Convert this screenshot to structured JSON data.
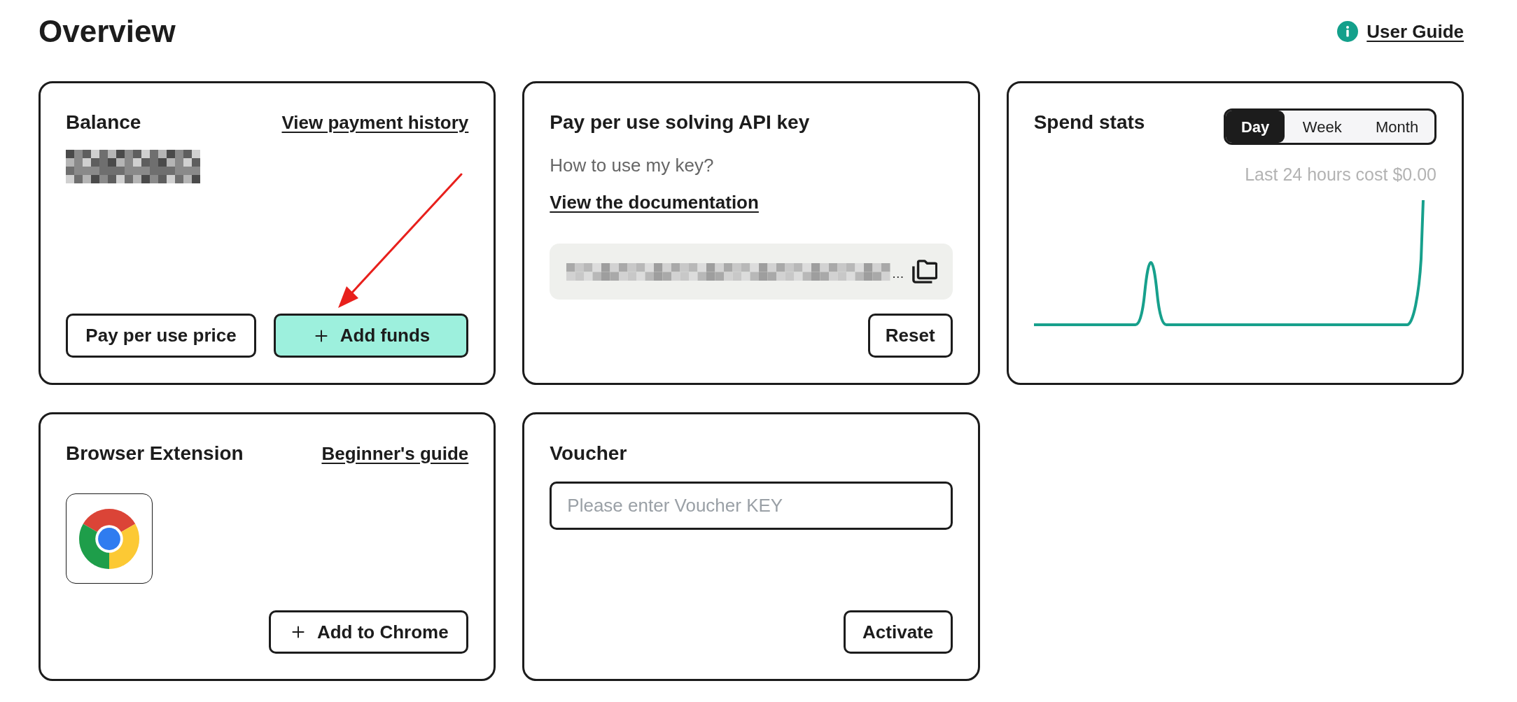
{
  "header": {
    "title": "Overview",
    "user_guide_link": "User Guide"
  },
  "balance_card": {
    "title": "Balance",
    "link": "View payment history",
    "buttons": [
      {
        "label": "Pay per use price",
        "kind": "plain"
      },
      {
        "label": "Add funds",
        "kind": "add_accent"
      }
    ]
  },
  "api_key_card": {
    "title": "Pay per use solving API key",
    "help_text": "How to use my key?",
    "link": "View the documentation",
    "key_field": {
      "ellipsis": "…"
    },
    "button": {
      "label": "Reset",
      "kind": "plain"
    }
  },
  "spend_stats_card": {
    "title": "Spend stats",
    "tabs": [
      {
        "label": "Day",
        "selected": true
      },
      {
        "label": "Week",
        "selected": false
      },
      {
        "label": "Month",
        "selected": false
      }
    ],
    "summary": "Last 24 hours cost $0.00"
  },
  "browser_extension_card": {
    "title": "Browser Extension",
    "link": "Beginner's guide",
    "button": {
      "label": "Add to Chrome",
      "kind": "add"
    }
  },
  "voucher_card": {
    "title": "Voucher",
    "input": {
      "placeholder": "Please enter Voucher KEY"
    },
    "button": {
      "label": "Activate",
      "kind": "plain"
    }
  }
}
